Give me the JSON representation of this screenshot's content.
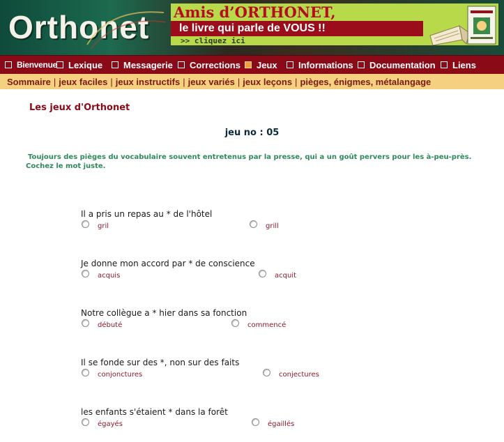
{
  "header": {
    "logo_text": "Orthonet",
    "ad": {
      "line1": "Amis d’ORTHONET,",
      "line2": "le livre qui parle de VOUS !!",
      "line3": ">> cliquez ici"
    }
  },
  "nav": {
    "items": [
      {
        "label": "Bienvenue",
        "active": false
      },
      {
        "label": "Lexique",
        "active": false
      },
      {
        "label": "Messagerie",
        "active": false
      },
      {
        "label": "Corrections",
        "active": false
      },
      {
        "label": "Jeux",
        "active": true
      },
      {
        "label": "Informations",
        "active": false
      },
      {
        "label": "Documentation",
        "active": false
      },
      {
        "label": "Liens",
        "active": false
      }
    ]
  },
  "subnav": {
    "items": [
      "Sommaire",
      "jeux faciles",
      "jeux instructifs",
      "jeux variés",
      "jeux leçons",
      "pièges, énigmes, métalangage"
    ]
  },
  "main": {
    "title": "Les jeux d'Orthonet",
    "game_number": "jeu no : 05",
    "instructions_line1": "Toujours des pièges du vocabulaire souvent entretenus par la presse, qui a un goût pervers pour les à-peu-près.",
    "instructions_line2": "Cochez le mot juste.",
    "questions": [
      {
        "text": "Il a pris un repas au * de l'hôtel",
        "option_a": "gril",
        "option_b": "grill"
      },
      {
        "text": "Je donne mon accord par * de conscience",
        "option_a": "acquis",
        "option_b": "acquit"
      },
      {
        "text": "Notre collègue a * hier dans sa fonction",
        "option_a": "débuté",
        "option_b": "commencé"
      },
      {
        "text": "Il se fonde sur des *, non sur des faits",
        "option_a": "conjonctures",
        "option_b": "conjectures"
      },
      {
        "text": "les enfants s'étaient * dans la forêt",
        "option_a": "égayés",
        "option_b": "égaillés"
      }
    ]
  },
  "colors": {
    "nav_background": "#8b0a17",
    "subnav_background": "#f4d080",
    "title_color": "#8b0a17",
    "instruction_color": "#2e8a5a",
    "option_color": "#8b1a2a"
  }
}
